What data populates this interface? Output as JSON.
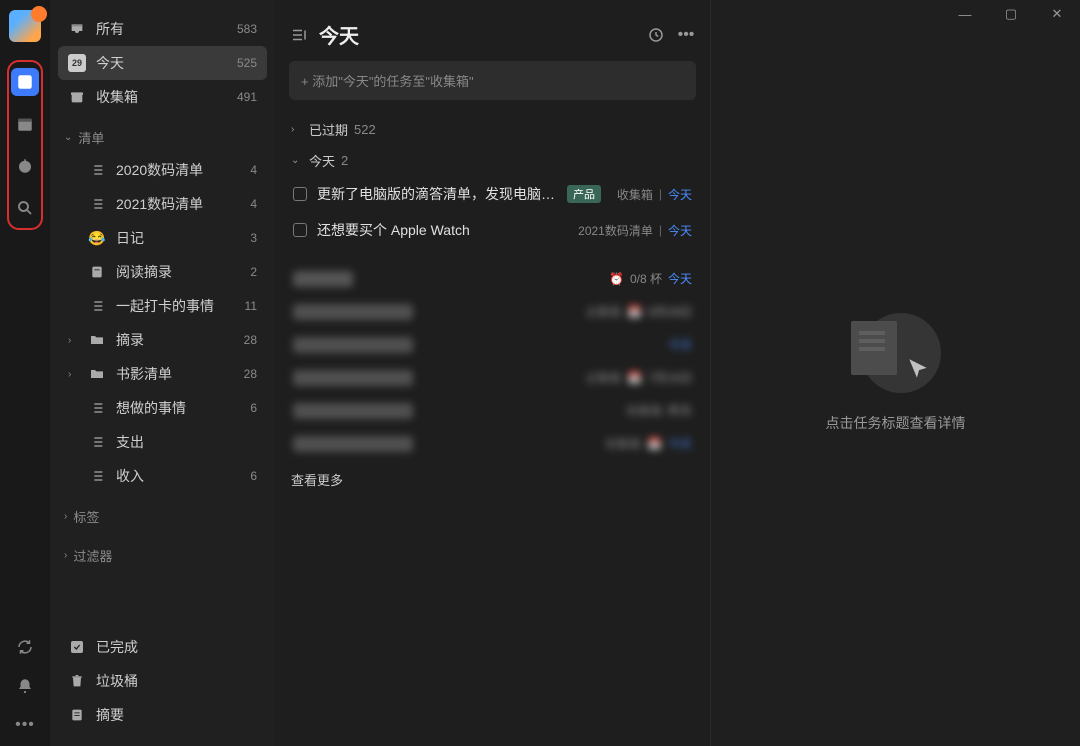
{
  "window": {
    "minimize": "—",
    "maximize": "▢",
    "close": "✕"
  },
  "avatar_badge": "",
  "smart_lists": [
    {
      "name": "所有",
      "count": "583",
      "icon": "inbox",
      "selected": false
    },
    {
      "name": "今天",
      "count": "525",
      "icon": "calendar",
      "selected": true,
      "cal_day": "29"
    },
    {
      "name": "收集箱",
      "count": "491",
      "icon": "archive",
      "selected": false
    }
  ],
  "lists_header": "清单",
  "lists": [
    {
      "name": "2020数码清单",
      "count": "4",
      "chev": "",
      "icon": "list",
      "dot": ""
    },
    {
      "name": "2021数码清单",
      "count": "4",
      "chev": "",
      "icon": "list",
      "dot": ""
    },
    {
      "name": "日记",
      "count": "3",
      "chev": "",
      "icon": "emoji",
      "dot": ""
    },
    {
      "name": "阅读摘录",
      "count": "2",
      "chev": "",
      "icon": "book",
      "dot": ""
    },
    {
      "name": "一起打卡的事情",
      "count": "11",
      "chev": "",
      "icon": "list",
      "dot": "#e85b9a"
    },
    {
      "name": "摘录",
      "count": "28",
      "chev": "›",
      "icon": "folder",
      "dot": ""
    },
    {
      "name": "书影清单",
      "count": "28",
      "chev": "›",
      "icon": "folder",
      "dot": ""
    },
    {
      "name": "想做的事情",
      "count": "6",
      "chev": "",
      "icon": "list",
      "dot": ""
    },
    {
      "name": "支出",
      "count": "",
      "chev": "",
      "icon": "list",
      "dot": "#e85b9a"
    },
    {
      "name": "收入",
      "count": "6",
      "chev": "",
      "icon": "list",
      "dot": "#3e7bfa"
    }
  ],
  "tags_header": "标签",
  "filters_header": "过滤器",
  "bottom": [
    {
      "name": "已完成",
      "icon": "check"
    },
    {
      "name": "垃圾桶",
      "icon": "trash"
    },
    {
      "name": "摘要",
      "icon": "summary"
    }
  ],
  "main": {
    "title": "今天",
    "add_placeholder": "+ 添加\"今天\"的任务至\"收集箱\"",
    "group_overdue": {
      "label": "已过期",
      "count": "522"
    },
    "group_today": {
      "label": "今天",
      "count": "2"
    },
    "tasks_today": [
      {
        "title": "更新了电脑版的滴答清单，发现电脑版的也…",
        "tag": "产品",
        "list": "收集箱",
        "date": "今天"
      },
      {
        "title": "还想要买个 Apple Watch",
        "tag": "",
        "list": "2021数码清单",
        "date": "今天"
      }
    ],
    "habit": {
      "progress": "0/8 杯",
      "date": "今天"
    },
    "blurred_meta": [
      {
        "list": "攴集箱",
        "icon": "📅",
        "date": "6月28日"
      },
      {
        "list": "",
        "icon": "",
        "date": "今天"
      },
      {
        "list": "攴集箱",
        "icon": "📅",
        "date": "7月16日"
      },
      {
        "list": "收集箱",
        "icon": "",
        "date": "昨天"
      },
      {
        "list": "收集箱",
        "icon": "📅",
        "date": "今天"
      }
    ],
    "view_more": "查看更多"
  },
  "detail_empty": "点击任务标题查看详情"
}
